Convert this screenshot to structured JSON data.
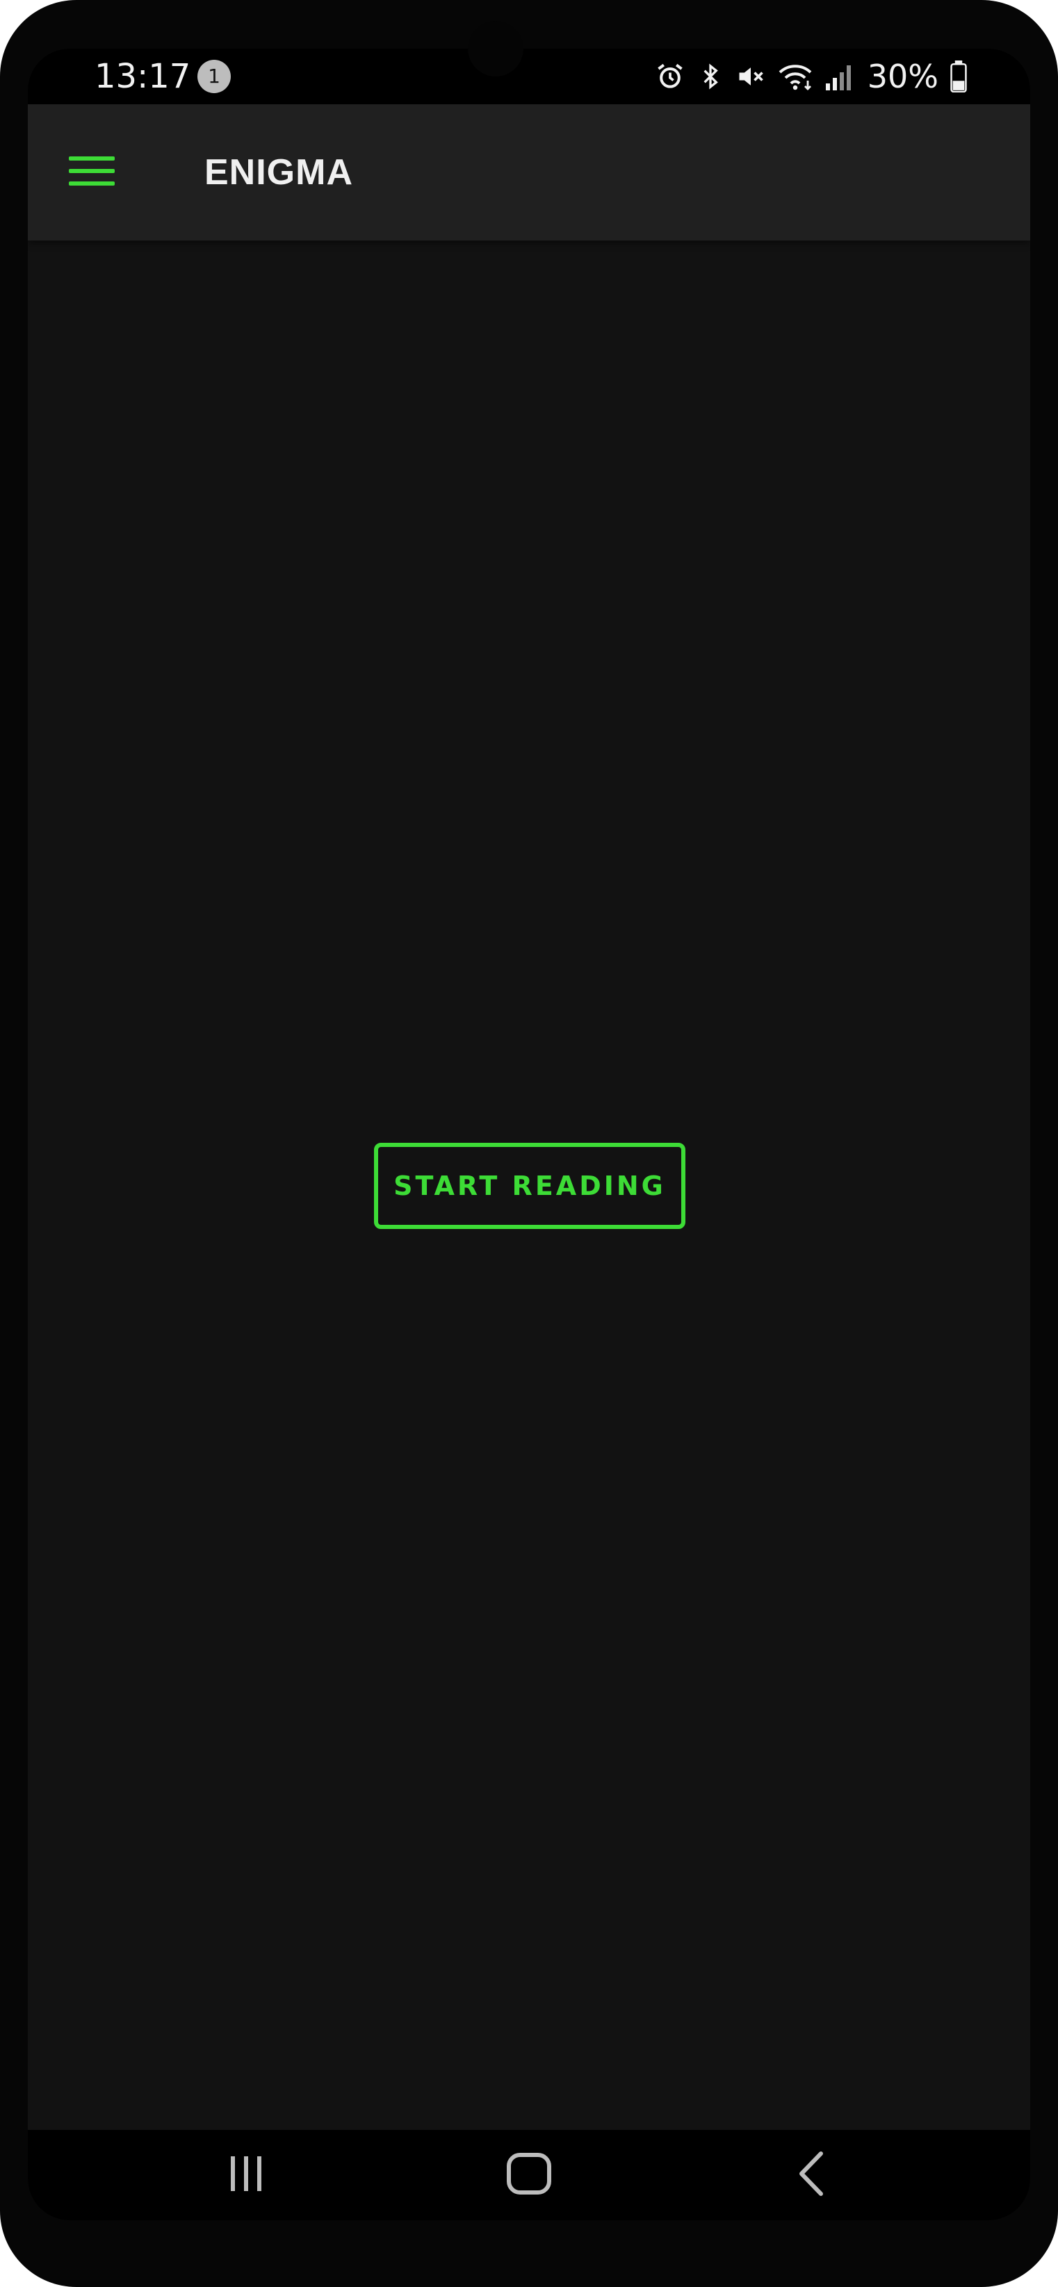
{
  "status_bar": {
    "time": "13:17",
    "notification_count": "1",
    "battery_percent": "30%",
    "icons": [
      "alarm-icon",
      "bluetooth-icon",
      "mute-icon",
      "wifi-icon",
      "signal-icon",
      "battery-icon"
    ]
  },
  "app_bar": {
    "title": "ENIGMA",
    "menu_icon": "hamburger-menu-icon"
  },
  "main": {
    "start_button_label": "START READING"
  },
  "nav_bar": {
    "icons": [
      "recent-apps-icon",
      "home-icon",
      "back-icon"
    ]
  },
  "colors": {
    "accent": "#3ddc36",
    "background": "#121212",
    "app_bar": "#202020"
  }
}
